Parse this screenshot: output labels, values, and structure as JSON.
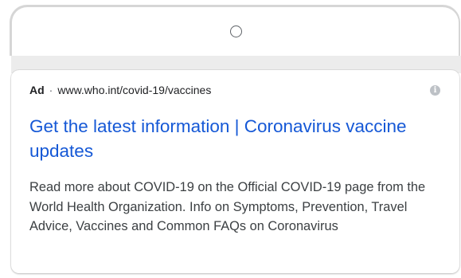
{
  "top": {
    "home_icon": "circle-home-icon"
  },
  "ad": {
    "label": "Ad",
    "separator": "·",
    "display_url": "www.who.int/covid-19/vaccines",
    "info_icon": "info-icon",
    "title": "Get the latest information | Coronavirus vaccine updates",
    "description": "Read more about COVID-19 on the Official COVID-19 page from the World Health Organization. Info on Symptoms, Prevention, Travel Advice, Vaccines and Common FAQs on Coronavirus",
    "colors": {
      "title": "#1558d6",
      "text": "#202124",
      "description": "#3c4043"
    }
  }
}
